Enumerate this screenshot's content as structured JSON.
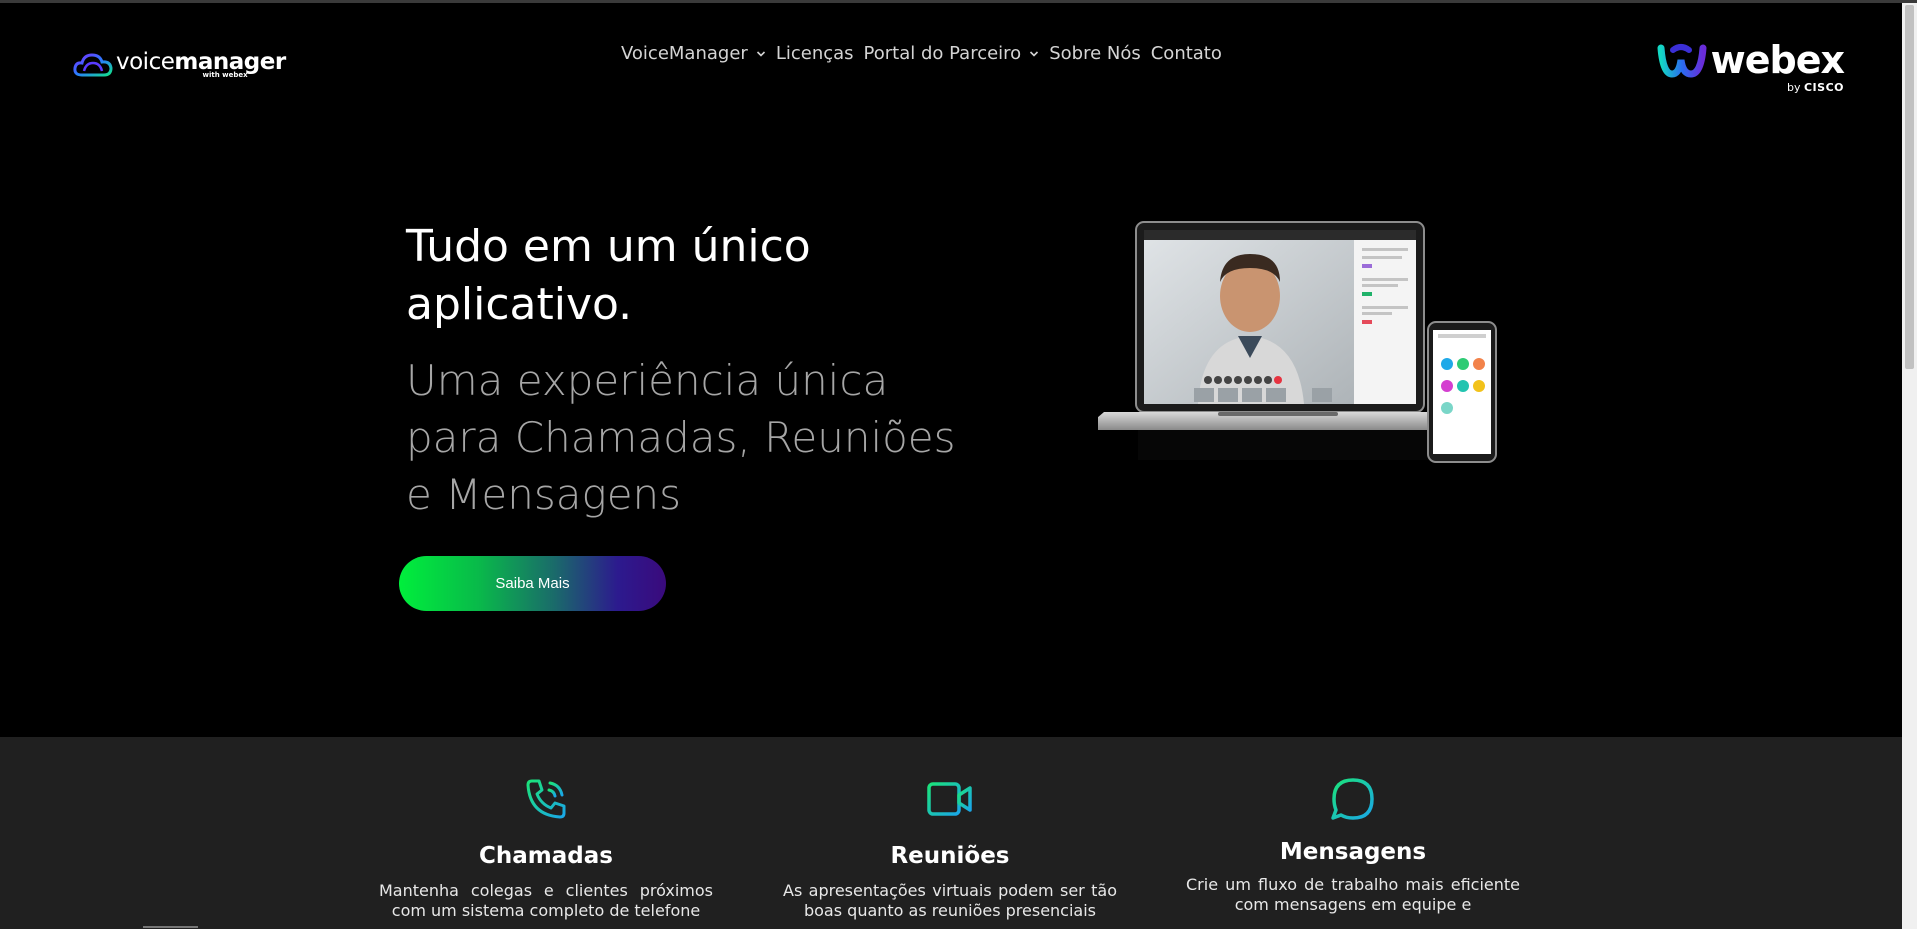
{
  "header": {
    "logo": {
      "name_light": "voice",
      "name_bold": "manager",
      "sub": "with webex"
    },
    "nav": [
      {
        "label": "VoiceManager",
        "has_dropdown": true
      },
      {
        "label": "Licenças",
        "has_dropdown": false
      },
      {
        "label": "Portal do Parceiro",
        "has_dropdown": true
      },
      {
        "label": "Sobre Nós",
        "has_dropdown": false
      },
      {
        "label": "Contato",
        "has_dropdown": false
      }
    ],
    "partner_logo": {
      "name": "webex",
      "by": "by",
      "company": "CISCO"
    }
  },
  "hero": {
    "title": "Tudo em um único aplicativo.",
    "subtitle": "Uma experiência única para Chamadas, Reuniões e Mensagens",
    "cta_label": "Saiba Mais"
  },
  "features": [
    {
      "icon": "phone-icon",
      "title": "Chamadas",
      "description": "Mantenha colegas e clientes próximos com um sistema completo de telefone"
    },
    {
      "icon": "video-camera-icon",
      "title": "Reuniões",
      "description": "As apresentações virtuais podem ser tão boas quanto as reuniões presenciais"
    },
    {
      "icon": "chat-bubble-icon",
      "title": "Mensagens",
      "description": "Crie um fluxo de trabalho mais eficiente com mensagens em equipe e"
    }
  ],
  "colors": {
    "background": "#000000",
    "features_bg": "#202020",
    "accent_green": "#00ef3c",
    "accent_purple": "#3a0a7c",
    "icon_gradient_start": "#1be37a",
    "icon_gradient_end": "#1aa7e8",
    "subtitle_gray": "#a6a6a6"
  }
}
